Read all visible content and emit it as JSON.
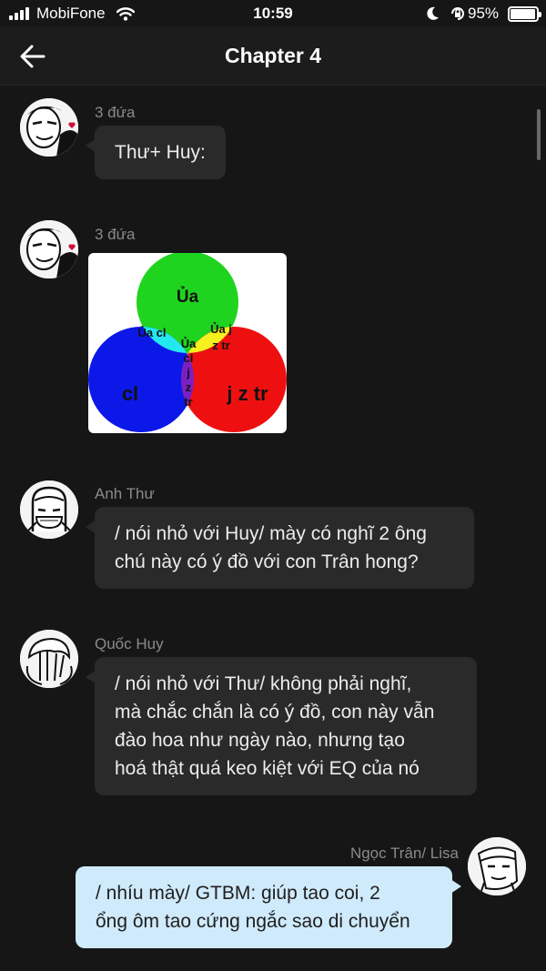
{
  "status_bar": {
    "carrier": "MobiFone",
    "time": "10:59",
    "battery_percent": "95%",
    "battery_level": 0.95
  },
  "header": {
    "title": "Chapter 4",
    "back_icon": "arrow-left-icon"
  },
  "messages": [
    {
      "sender": "3 đứa",
      "text": "Thư+ Huy:",
      "side": "left"
    },
    {
      "sender": "3 đứa",
      "type": "image",
      "side": "left",
      "image_labels": {
        "top": "Ủa",
        "left_overlap": "Ủa cl",
        "right_overlap_1": "Ủa j",
        "right_overlap_2": "z tr",
        "center_1": "Ủa",
        "center_2": "cl",
        "bottom_overlap_1": "j",
        "bottom_overlap_2": "z",
        "bottom_overlap_3": "tr",
        "left": "cl",
        "right": "j z tr"
      },
      "colors": {
        "green": "#1fd41f",
        "blue": "#0b18e8",
        "red": "#ee1010",
        "cyan": "#24e8f0",
        "yellow": "#f5f01e",
        "purple": "#7a1fc4",
        "white": "#ffffff"
      }
    },
    {
      "sender": "Anh Thư",
      "side": "left",
      "lines": [
        "/ nói nhỏ với Huy/ mày có nghĩ 2 ông",
        "chú này có ý đồ với con Trân hong?"
      ]
    },
    {
      "sender": "Quốc Huy",
      "side": "left",
      "lines": [
        "/ nói nhỏ với Thư/ không phải nghĩ,",
        "mà chắc chắn là có ý đồ, con này vẫn",
        "đào hoa như ngày nào, nhưng tạo",
        "hoá thật quá keo kiệt với EQ của nó"
      ]
    },
    {
      "sender": "Ngọc Trân/ Lisa",
      "side": "right",
      "lines": [
        "/ nhíu mày/ GTBM: giúp tao coi, 2",
        "ổng ôm tao cứng ngắc sao di chuyển"
      ]
    }
  ],
  "theme": {
    "background": "#161616",
    "bubble": "#2a2a2a",
    "self_bubble": "#cfeafb"
  }
}
